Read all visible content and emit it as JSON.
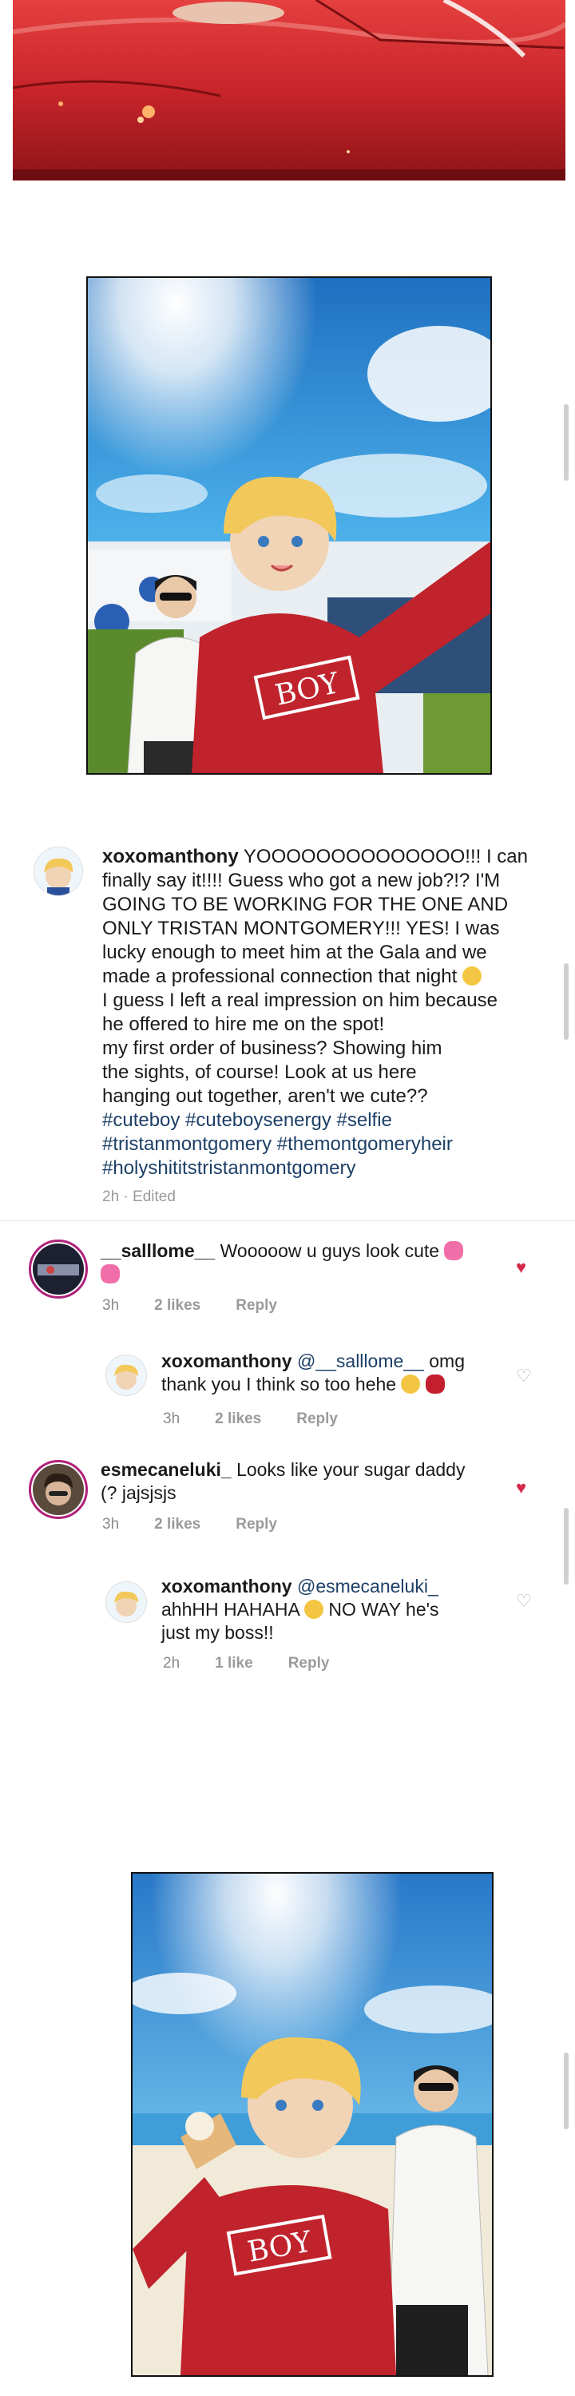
{
  "caption": {
    "username": "xoxomanthony",
    "lines": [
      "YOOOOOOOOOOOOOO!!! I can",
      "finally say it!!!! Guess who got a new job?!? I'M",
      "GOING TO BE WORKING FOR THE ONE AND",
      "ONLY TRISTAN MONTGOMERY!!! YES! I was",
      "lucky enough to meet him at the Gala and we",
      "made a professional connection that night",
      "I guess I left a real impression on him because",
      "he offered to hire me on the spot!",
      "my first order of business? Showing him",
      "the sights, of course! Look at us here",
      "hanging out together, aren't we cute??"
    ],
    "hashtags": [
      "#cuteboy #cuteboysenergy #selfie",
      "#tristanmontgomery #themontgomeryheir",
      "#holyshititstristanmontgomery"
    ],
    "meta": "2h · Edited"
  },
  "comments": [
    {
      "username": "__salllome__",
      "text_line1": "Wooooow u guys look cute",
      "time": "3h",
      "likes": "2 likes",
      "reply": "Reply"
    },
    {
      "username": "xoxomanthony",
      "mention": "@__salllome__",
      "text_line1": "omg",
      "text_line2": "thank you I think so too hehe",
      "time": "3h",
      "likes": "2 likes",
      "reply": "Reply"
    },
    {
      "username": "esmecaneluki_",
      "text_line1": "Looks like your sugar daddy",
      "text_line2": "(? jajsjsjs",
      "time": "3h",
      "likes": "2 likes",
      "reply": "Reply"
    },
    {
      "username": "xoxomanthony",
      "mention": "@esmecaneluki_",
      "text_line2": "ahhHH HAHAHA",
      "text_line2b": "NO WAY he's",
      "text_line3": "just my boss!!",
      "time": "2h",
      "likes": "1 like",
      "reply": "Reply"
    }
  ],
  "panels": {
    "selfie_1_shirt": "BOY",
    "selfie_2_shirt": "BOY"
  },
  "colors": {
    "car_red": "#c8252b",
    "sky_blue": "#3d9ee0",
    "shirt_red": "#c0232c",
    "hair_blonde": "#f3c85a",
    "heart_red": "#d6294a",
    "hashtag_blue": "#1d3f66",
    "story_ring": "#b1217a"
  }
}
